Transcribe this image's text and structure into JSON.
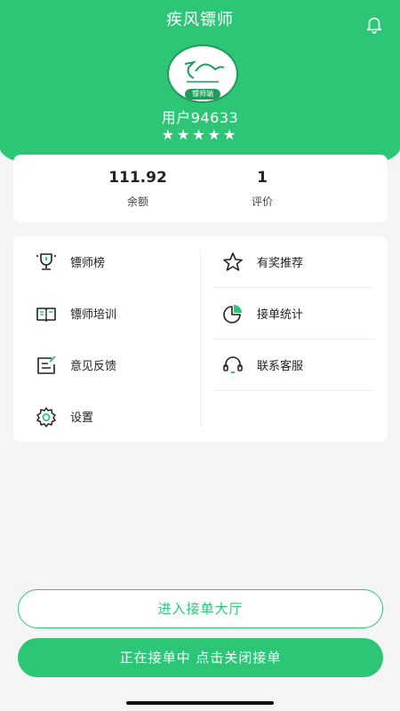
{
  "header": {
    "title": "疾风镖师",
    "notification_icon": "bell-icon",
    "avatar_icon": "logo-icon",
    "avatar_tag": "镖师端",
    "username": "用户94633",
    "rating_stars": 5,
    "stars_text": "★★★★★",
    "brand_color": "#2cc676"
  },
  "stats": [
    {
      "value": "111.92",
      "label": "余额"
    },
    {
      "value": "1",
      "label": "评价"
    }
  ],
  "menu": [
    {
      "label": "镖师榜",
      "icon": "trophy-icon"
    },
    {
      "label": "有奖推荐",
      "icon": "star-icon"
    },
    {
      "label": "镖师培训",
      "icon": "book-icon"
    },
    {
      "label": "接单统计",
      "icon": "pie-chart-icon"
    },
    {
      "label": "意见反馈",
      "icon": "feedback-icon"
    },
    {
      "label": "联系客服",
      "icon": "headset-icon"
    },
    {
      "label": "设置",
      "icon": "gear-icon"
    }
  ],
  "buttons": {
    "enter_hall": "进入接单大厅",
    "toggle_orders": "正在接单中 点击关闭接单"
  }
}
